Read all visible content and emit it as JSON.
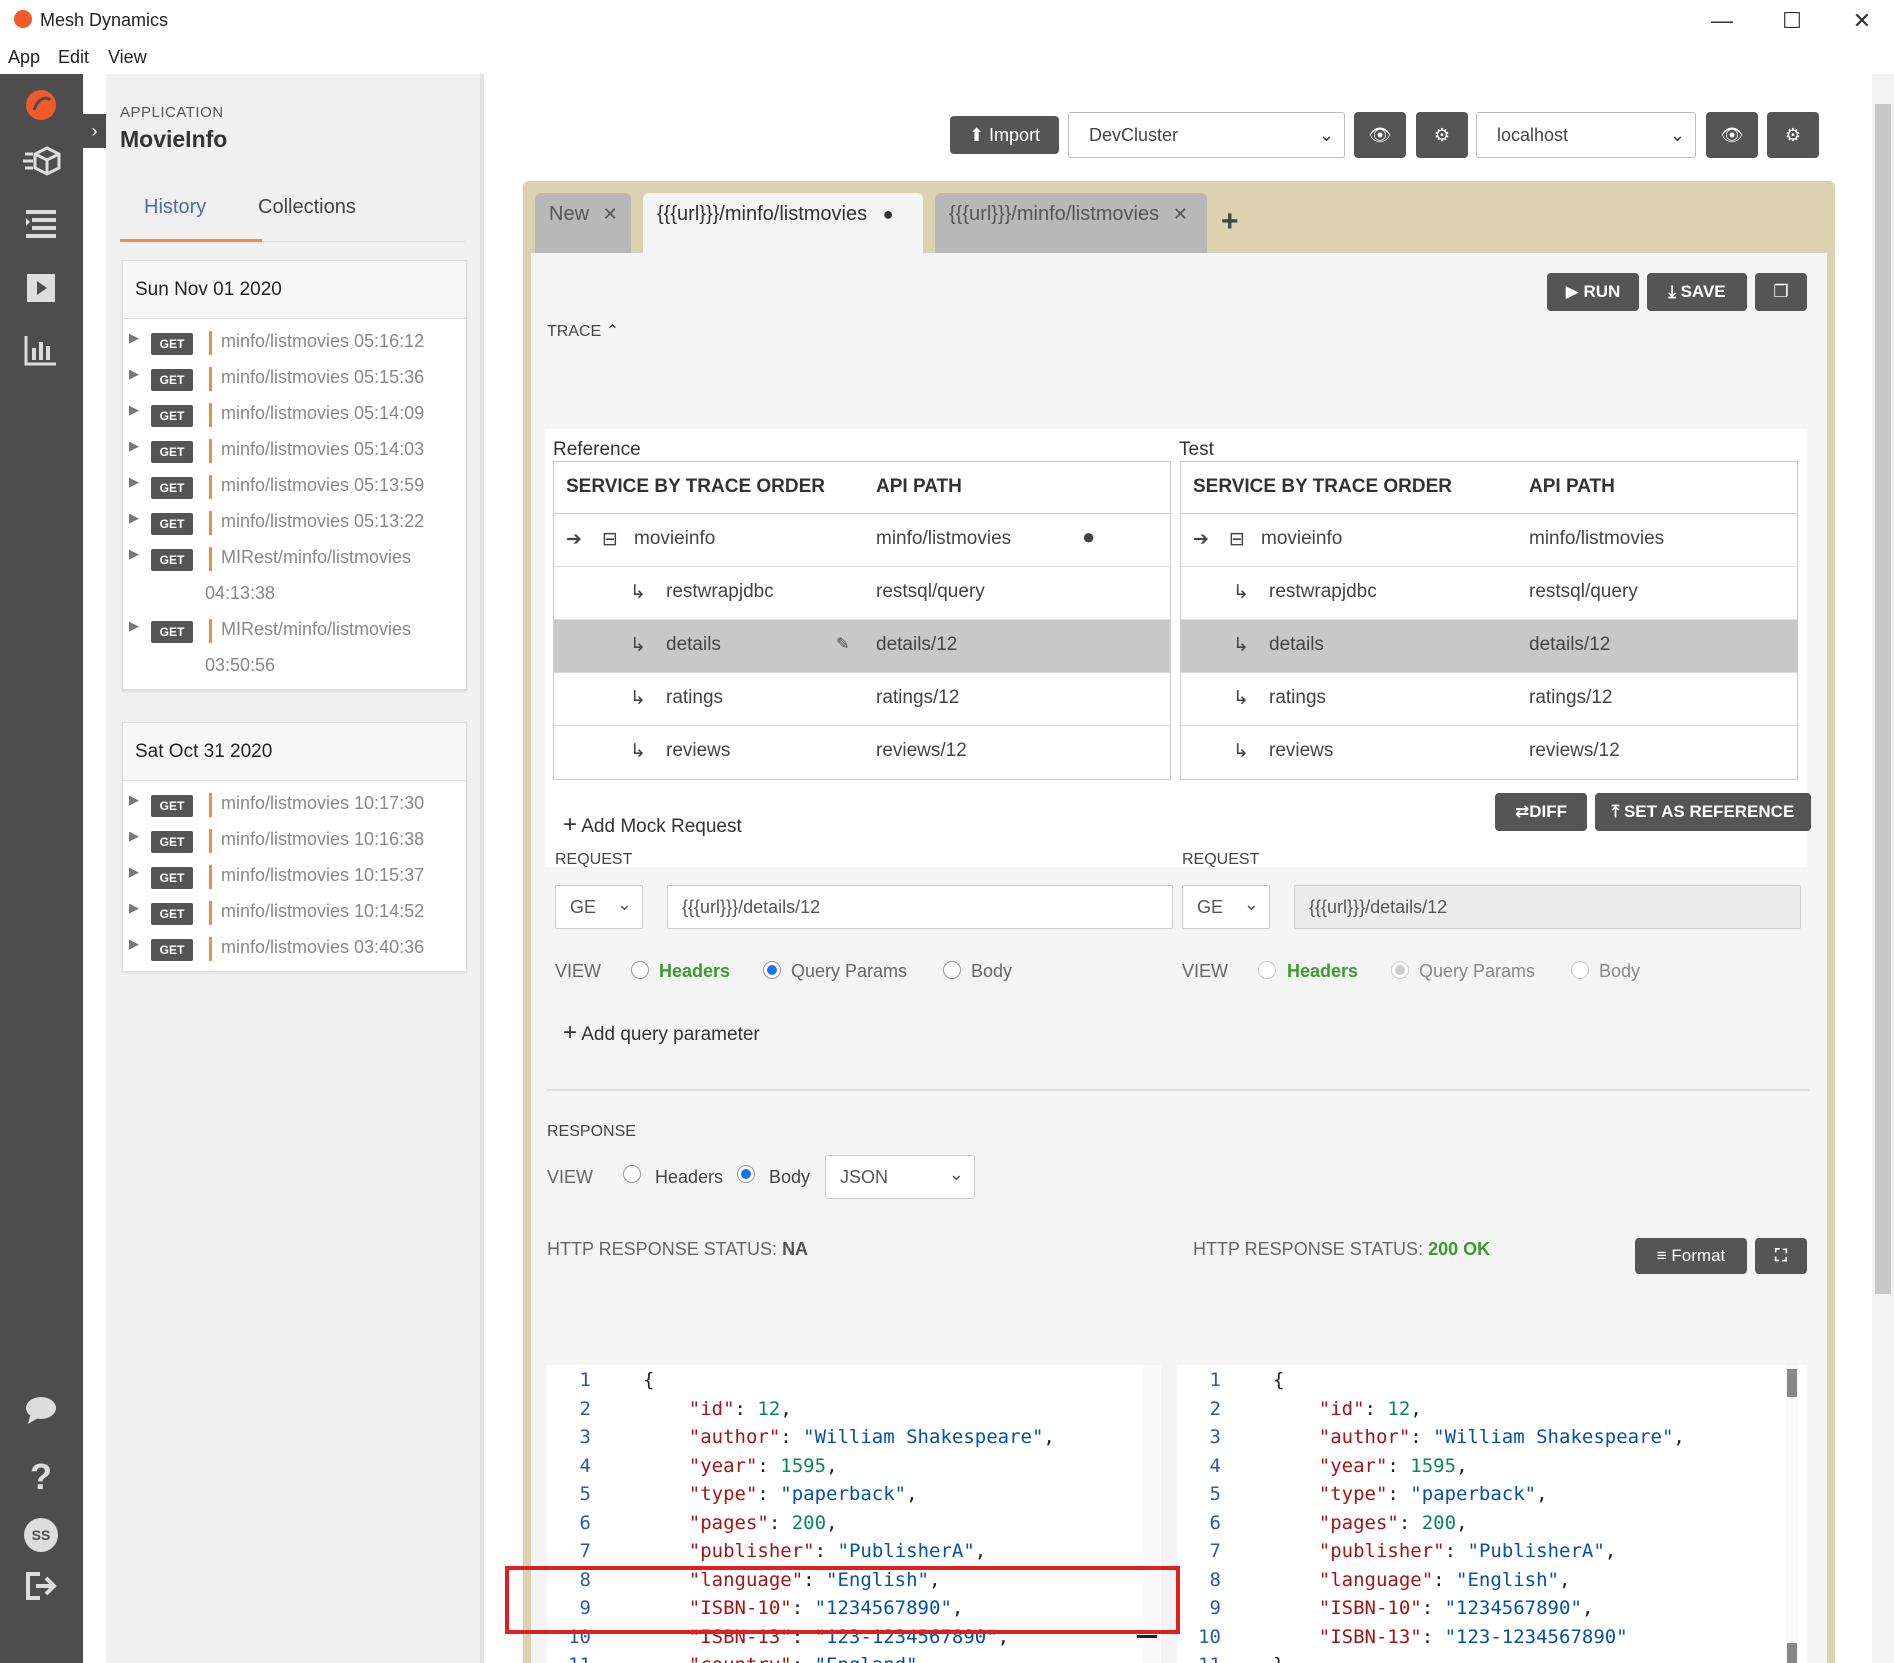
{
  "window": {
    "title": "Mesh Dynamics",
    "minimize": "—",
    "maximize": "☐",
    "close": "✕"
  },
  "menu": [
    "App",
    "Edit",
    "View"
  ],
  "sidebar": {
    "app_label": "APPLICATION",
    "app_name": "MovieInfo",
    "tabs": [
      "History",
      "Collections"
    ],
    "groups": [
      {
        "date": "Sun Nov 01 2020",
        "items": [
          {
            "method": "GET",
            "path": "minfo/listmovies 05:16:12"
          },
          {
            "method": "GET",
            "path": "minfo/listmovies 05:15:36"
          },
          {
            "method": "GET",
            "path": "minfo/listmovies 05:14:09"
          },
          {
            "method": "GET",
            "path": "minfo/listmovies 05:14:03"
          },
          {
            "method": "GET",
            "path": "minfo/listmovies 05:13:59"
          },
          {
            "method": "GET",
            "path": "minfo/listmovies 05:13:22"
          },
          {
            "method": "GET",
            "path": "MIRest/minfo/listmovies",
            "time": "04:13:38"
          },
          {
            "method": "GET",
            "path": "MIRest/minfo/listmovies",
            "time": "03:50:56"
          }
        ]
      },
      {
        "date": "Sat Oct 31 2020",
        "items": [
          {
            "method": "GET",
            "path": "minfo/listmovies 10:17:30"
          },
          {
            "method": "GET",
            "path": "minfo/listmovies 10:16:38"
          },
          {
            "method": "GET",
            "path": "minfo/listmovies 10:15:37"
          },
          {
            "method": "GET",
            "path": "minfo/listmovies 10:14:52"
          },
          {
            "method": "GET",
            "path": "minfo/listmovies 03:40:36"
          }
        ]
      }
    ]
  },
  "toolbar": {
    "import": "Import",
    "cluster": "DevCluster",
    "host": "localhost"
  },
  "tabs": [
    {
      "label": "New"
    },
    {
      "label": "{{{url}}}/minfo/listmovies"
    },
    {
      "label": "{{{url}}}/minfo/listmovies"
    }
  ],
  "actions": {
    "run": "RUN",
    "save": "SAVE",
    "diff": "DIFF",
    "set_reference": "SET AS REFERENCE",
    "format": "Format"
  },
  "trace": {
    "label": "TRACE",
    "reference_label": "Reference",
    "test_label": "Test",
    "col_service": "SERVICE BY TRACE ORDER",
    "col_api": "API PATH",
    "rows": [
      {
        "service": "movieinfo",
        "api": "minfo/listmovies"
      },
      {
        "service": "restwrapjdbc",
        "api": "restsql/query"
      },
      {
        "service": "details",
        "api": "details/12"
      },
      {
        "service": "ratings",
        "api": "ratings/12"
      },
      {
        "service": "reviews",
        "api": "reviews/12"
      }
    ],
    "add_mock": "Add Mock Request"
  },
  "request": {
    "label": "REQUEST",
    "method": "GE",
    "url": "{{{url}}}/details/12",
    "view_label": "VIEW",
    "view_options": [
      "Headers",
      "Query Params",
      "Body"
    ],
    "add_param": "Add query parameter"
  },
  "response": {
    "label": "RESPONSE",
    "view_label": "VIEW",
    "view_options": [
      "Headers",
      "Body"
    ],
    "format": "JSON",
    "status_label": "HTTP RESPONSE STATUS:",
    "left_status": "NA",
    "right_status": "200 OK",
    "left_lines": [
      "{",
      "    \"id\": 12,",
      "    \"author\": \"William Shakespeare\",",
      "    \"year\": 1595,",
      "    \"type\": \"paperback\",",
      "    \"pages\": 200,",
      "    \"publisher\": \"PublisherA\",",
      "    \"language\": \"English\",",
      "    \"ISBN-10\": \"1234567890\",",
      "    \"ISBN-13\": \"123-1234567890\",",
      "    \"country\": \"England\"",
      "}"
    ],
    "right_lines": [
      "{",
      "    \"id\": 12,",
      "    \"author\": \"William Shakespeare\",",
      "    \"year\": 1595,",
      "    \"type\": \"paperback\",",
      "    \"pages\": 200,",
      "    \"publisher\": \"PublisherA\",",
      "    \"language\": \"English\",",
      "    \"ISBN-10\": \"1234567890\",",
      "    \"ISBN-13\": \"123-1234567890\"",
      "}"
    ]
  },
  "colors": {
    "accent": "#f28c45",
    "highlight_box": "#e02020",
    "ok_green": "#3c9a2e",
    "rail": "#4d4d4d"
  },
  "user_initials": "SS"
}
